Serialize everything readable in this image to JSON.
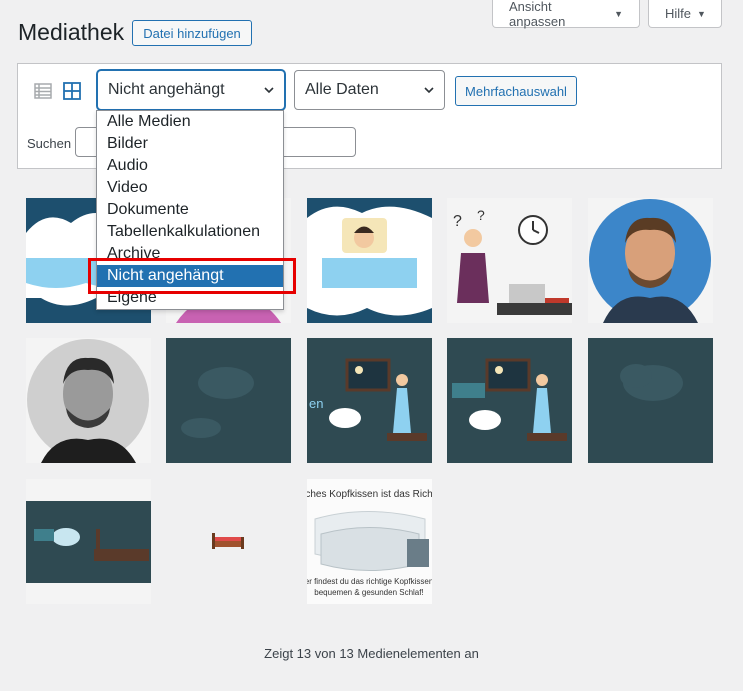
{
  "header": {
    "screen_options_label": "Ansicht anpassen",
    "help_label": "Hilfe",
    "page_title": "Mediathek",
    "add_file_label": "Datei hinzufügen"
  },
  "toolbar": {
    "attachment_filter_value": "Nicht angehängt",
    "date_filter_value": "Alle Daten",
    "bulk_select_label": "Mehrfachauswahl",
    "search_label": "Suchen",
    "search_value": ""
  },
  "dropdown": {
    "options": [
      "Alle Medien",
      "Bilder",
      "Audio",
      "Video",
      "Dokumente",
      "Tabellenkalkulationen",
      "Archive",
      "Nicht angehängt",
      "Eigene"
    ],
    "selected_index": 7
  },
  "media_tiles": {
    "tile_13_caption_top": "ches Kopfkissen ist das Rich",
    "tile_13_caption_bottom_1": "er findest du das richtige Kopfkissen",
    "tile_13_caption_bottom_2": "bequemen & gesunden Schlaf!"
  },
  "footer": {
    "count_text": "Zeigt 13 von 13 Medienelementen an"
  },
  "colors": {
    "accent": "#2271b1",
    "highlight": "#e60000",
    "teal_bg": "#2f4a52"
  }
}
